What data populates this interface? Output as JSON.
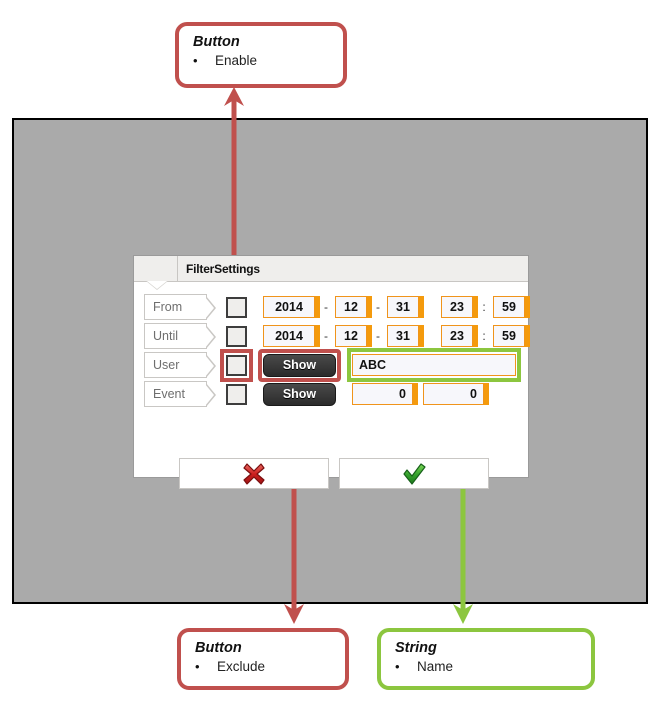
{
  "annotations": [
    {
      "id": "enable",
      "type": "Button",
      "item": "Enable",
      "bullet": "•",
      "color": "#c0504d"
    },
    {
      "id": "exclude",
      "type": "Button",
      "item": "Exclude",
      "bullet": "•",
      "color": "#c0504d"
    },
    {
      "id": "name",
      "type": "String",
      "item": "Name",
      "bullet": "•",
      "color": "#8cc63f"
    }
  ],
  "dialog": {
    "title": "FilterSettings",
    "rows": [
      {
        "label": "From",
        "checkbox_checked": false,
        "date": {
          "year": "2014",
          "month": "12",
          "day": "31",
          "hour": "23",
          "minute": "59"
        },
        "date_sep": "-",
        "time_sep": ":"
      },
      {
        "label": "Until",
        "checkbox_checked": false,
        "date": {
          "year": "2014",
          "month": "12",
          "day": "31",
          "hour": "23",
          "minute": "59"
        },
        "date_sep": "-",
        "time_sep": ":"
      },
      {
        "label": "User",
        "checkbox_checked": false,
        "button": "Show",
        "text_value": "ABC"
      },
      {
        "label": "Event",
        "checkbox_checked": false,
        "button": "Show",
        "num_a": "0",
        "num_b": "0"
      }
    ],
    "footer": {
      "cancel_icon": "cross-icon",
      "confirm_icon": "check-icon"
    }
  },
  "colors": {
    "accent_red": "#c0504d",
    "accent_green": "#8cc63f",
    "field_orange": "#f0941b",
    "field_orange_edge": "#f49a0d",
    "canvas_gray": "#aaaaaa",
    "button_dark": "#2b2b2b"
  }
}
